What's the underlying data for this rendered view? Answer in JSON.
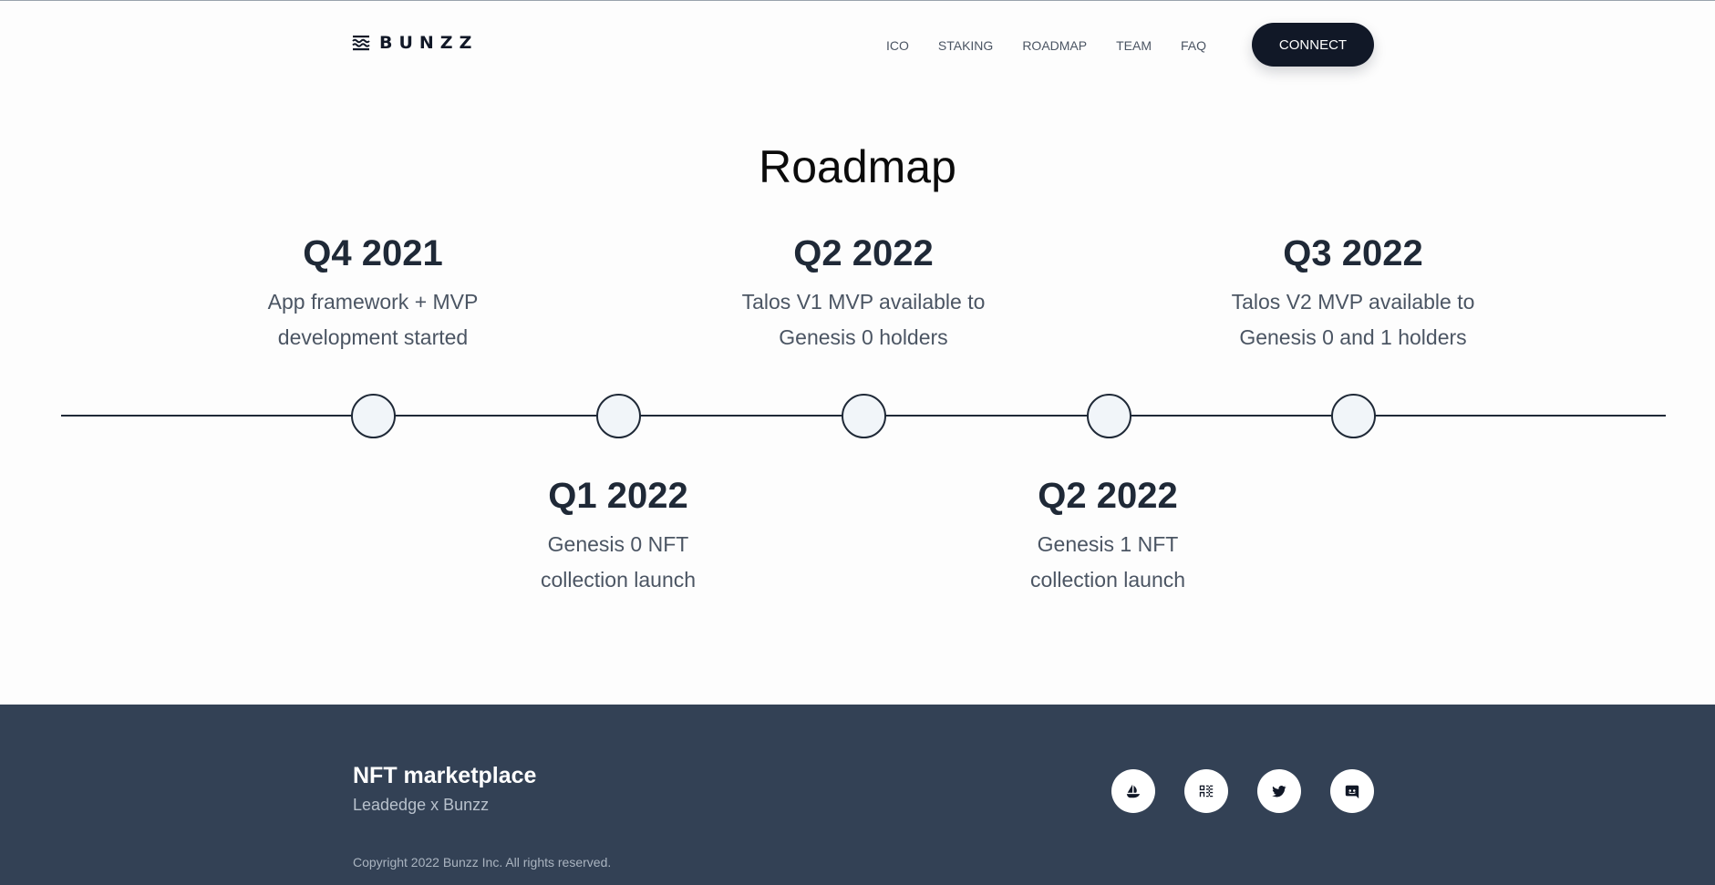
{
  "header": {
    "logo_text": "BUNZZ",
    "nav": [
      "ICO",
      "STAKING",
      "ROADMAP",
      "TEAM",
      "FAQ"
    ],
    "connect_label": "CONNECT"
  },
  "roadmap": {
    "title": "Roadmap",
    "milestones": [
      {
        "quarter": "Q4 2021",
        "line1": "App framework + MVP",
        "line2": "development started"
      },
      {
        "quarter": "Q1 2022",
        "line1": "Genesis 0 NFT",
        "line2": "collection launch"
      },
      {
        "quarter": "Q2 2022",
        "line1": "Talos V1 MVP available to",
        "line2": "Genesis 0 holders"
      },
      {
        "quarter": "Q2 2022",
        "line1": "Genesis 1 NFT",
        "line2": "collection launch"
      },
      {
        "quarter": "Q3 2022",
        "line1": "Talos V2 MVP available to",
        "line2": "Genesis 0 and 1 holders"
      }
    ]
  },
  "footer": {
    "title": "NFT marketplace",
    "subtitle": "Leadedge x Bunzz",
    "copyright": "Copyright 2022 Bunzz Inc. All rights reserved.",
    "socials": [
      "opensea-icon",
      "rarible-icon",
      "twitter-icon",
      "discord-icon"
    ]
  },
  "colors": {
    "dark": "#111827",
    "footer_bg": "#334155",
    "text_muted": "#4b5563",
    "node_fill": "#f1f5f9"
  }
}
